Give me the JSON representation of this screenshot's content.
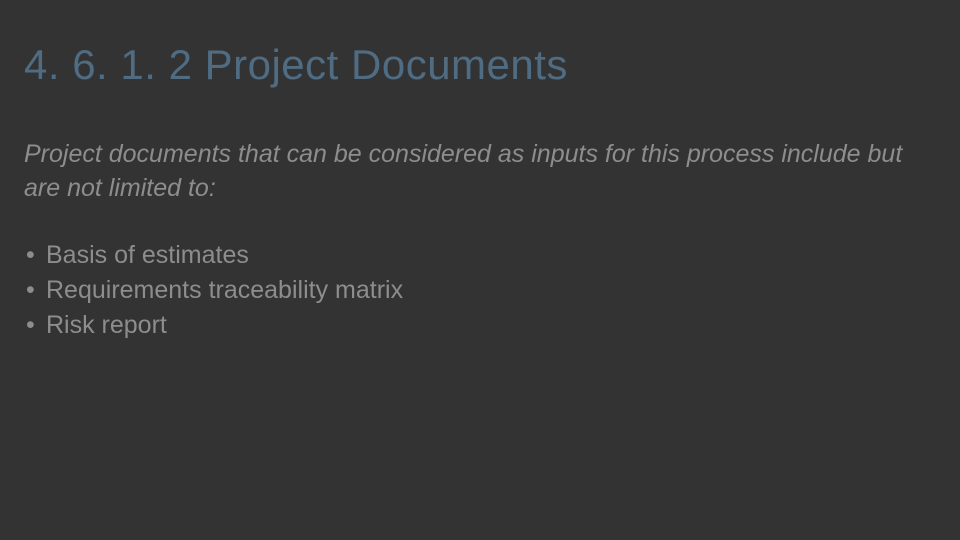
{
  "slide": {
    "title": "4. 6. 1. 2 Project Documents",
    "intro": "Project documents that can be considered as inputs for this process include but are not limited to:",
    "bullets": [
      "Basis of estimates",
      "Requirements traceability matrix",
      "Risk report"
    ]
  }
}
